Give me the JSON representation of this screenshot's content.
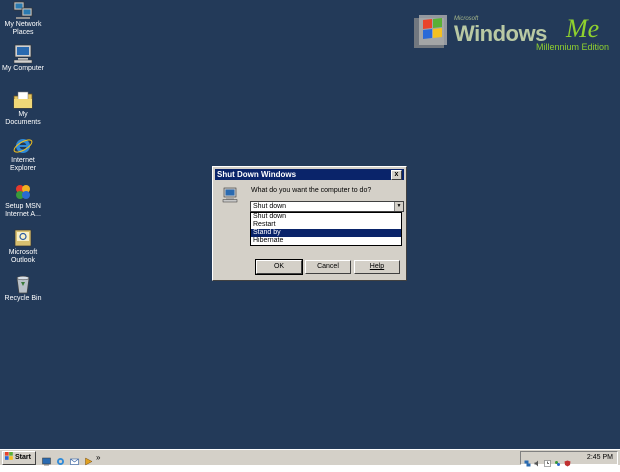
{
  "desktop": {
    "icons": [
      {
        "label": "My Network Places",
        "icon": "network-places-icon"
      },
      {
        "label": "My Computer",
        "icon": "my-computer-icon"
      },
      {
        "label": "My Documents",
        "icon": "my-documents-icon"
      },
      {
        "label": "Internet Explorer",
        "icon": "internet-explorer-icon"
      },
      {
        "label": "Setup MSN Internet A...",
        "icon": "msn-setup-icon"
      },
      {
        "label": "Microsoft Outlook",
        "icon": "outlook-icon"
      },
      {
        "label": "Recycle Bin",
        "icon": "recycle-bin-icon"
      }
    ],
    "background_color": "#233a59"
  },
  "logo": {
    "microsoft": "Microsoft",
    "windows": "Windows",
    "me": "Me",
    "edition": "Millennium Edition"
  },
  "dialog": {
    "title": "Shut Down Windows",
    "close_label": "x",
    "prompt": "What do you want the computer to do?",
    "selected_value": "Shut down",
    "options": [
      "Shut down",
      "Restart",
      "Stand by",
      "Hibernate"
    ],
    "highlighted_option": "Stand by",
    "ok_label": "OK",
    "cancel_label": "Cancel",
    "help_label": "Help"
  },
  "taskbar": {
    "start_label": "Start",
    "quicklaunch": [
      "show-desktop-icon",
      "internet-explorer-icon",
      "outlook-express-icon",
      "media-player-icon"
    ],
    "chevron": "»",
    "tray_icons": [
      "network-icon",
      "volume-icon",
      "task-scheduler-icon",
      "msn-icon",
      "antivirus-icon"
    ],
    "clock": "2:45 PM"
  },
  "colors": {
    "title_bar": "#0a246a",
    "window_face": "#d4d0c8",
    "selection": "#0a246a"
  }
}
